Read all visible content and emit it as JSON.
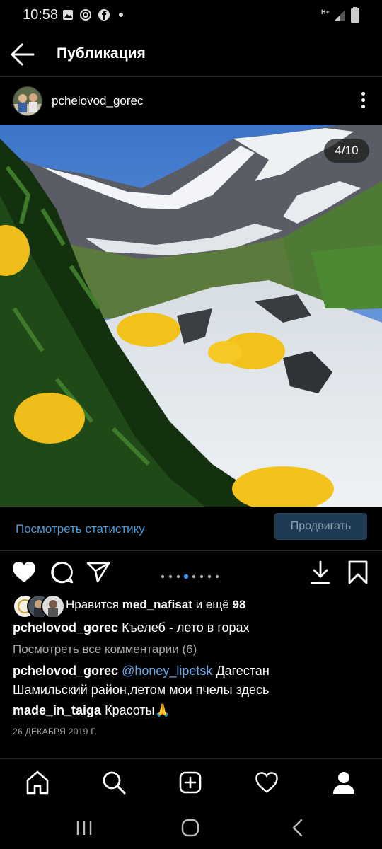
{
  "status_bar": {
    "time": "10:58",
    "network": "H+"
  },
  "header": {
    "title": "Публикация"
  },
  "post": {
    "author": "pchelovod_gorec",
    "counter": "4/10",
    "stats_link": "Посмотреть статистику",
    "promote_button": "Продвигать",
    "likes": {
      "prefix": "Нравится",
      "user": "med_nafisat",
      "middle": "и ещё",
      "count": "98"
    },
    "caption": {
      "user": "pchelovod_gorec",
      "text": "Къелеб - лето в горах"
    },
    "view_comments": "Посмотреть все комментарии (6)",
    "comments": [
      {
        "user": "pchelovod_gorec",
        "mention": "@honey_lipetsk",
        "text_line1": "Дагестан",
        "text_line2": "Шамильский район,летом мои пчелы  здесь"
      },
      {
        "user": "made_in_taiga",
        "text": "Красоты🙏"
      }
    ],
    "date": "26 ДЕКАБРЯ 2019 Г.",
    "carousel": {
      "total_dots": 8,
      "active_index": 3
    }
  },
  "colors": {
    "link": "#4a9ad9",
    "promote_bg": "#1e3a55",
    "mention": "#6aa9e8"
  },
  "icons": {
    "back": "arrow-left-icon",
    "more": "more-vertical-icon",
    "like": "heart-filled-icon",
    "comment": "comment-icon",
    "share": "send-icon",
    "download": "download-icon",
    "save": "bookmark-icon",
    "nav": [
      "home-icon",
      "search-icon",
      "add-post-icon",
      "activity-heart-icon",
      "profile-icon"
    ],
    "system": [
      "recents-icon",
      "home-circle-icon",
      "system-back-icon"
    ]
  }
}
